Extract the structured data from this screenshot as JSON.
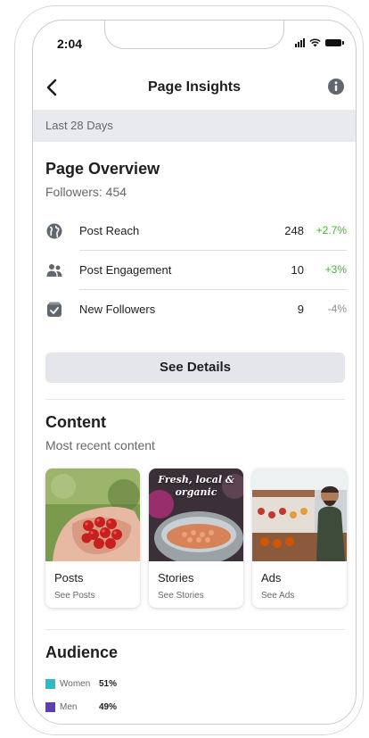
{
  "status_bar": {
    "time": "2:04"
  },
  "header": {
    "title": "Page Insights"
  },
  "date_range": "Last 28 Days",
  "overview": {
    "title": "Page Overview",
    "followers": "Followers: 454",
    "metrics": [
      {
        "label": "Post Reach",
        "value": "248",
        "change": "+2.7%",
        "icon": "globe-icon",
        "change_color": "#42b72a"
      },
      {
        "label": "Post Engagement",
        "value": "10",
        "change": "+3%",
        "icon": "people-icon",
        "change_color": "#42b72a"
      },
      {
        "label": "New Followers",
        "value": "9",
        "change": "-4%",
        "icon": "follower-card-icon",
        "change_color": "#8a8d91"
      }
    ],
    "button_label": "See Details"
  },
  "content": {
    "title": "Content",
    "subtitle": "Most recent content",
    "cards": [
      {
        "title": "Posts",
        "link": "See Posts",
        "image": "hands-holding-tomatoes"
      },
      {
        "title": "Stories",
        "link": "See Stories",
        "image": "bowl-of-beans",
        "overlay": "Fresh, local & organic"
      },
      {
        "title": "Ads",
        "link": "See Ads",
        "image": "market-vendor"
      }
    ]
  },
  "audience": {
    "title": "Audience",
    "legend": [
      {
        "label": "Women",
        "value": "51%",
        "color": "#2bbcc8"
      },
      {
        "label": "Men",
        "value": "49%",
        "color": "#5b3fb8"
      }
    ]
  }
}
